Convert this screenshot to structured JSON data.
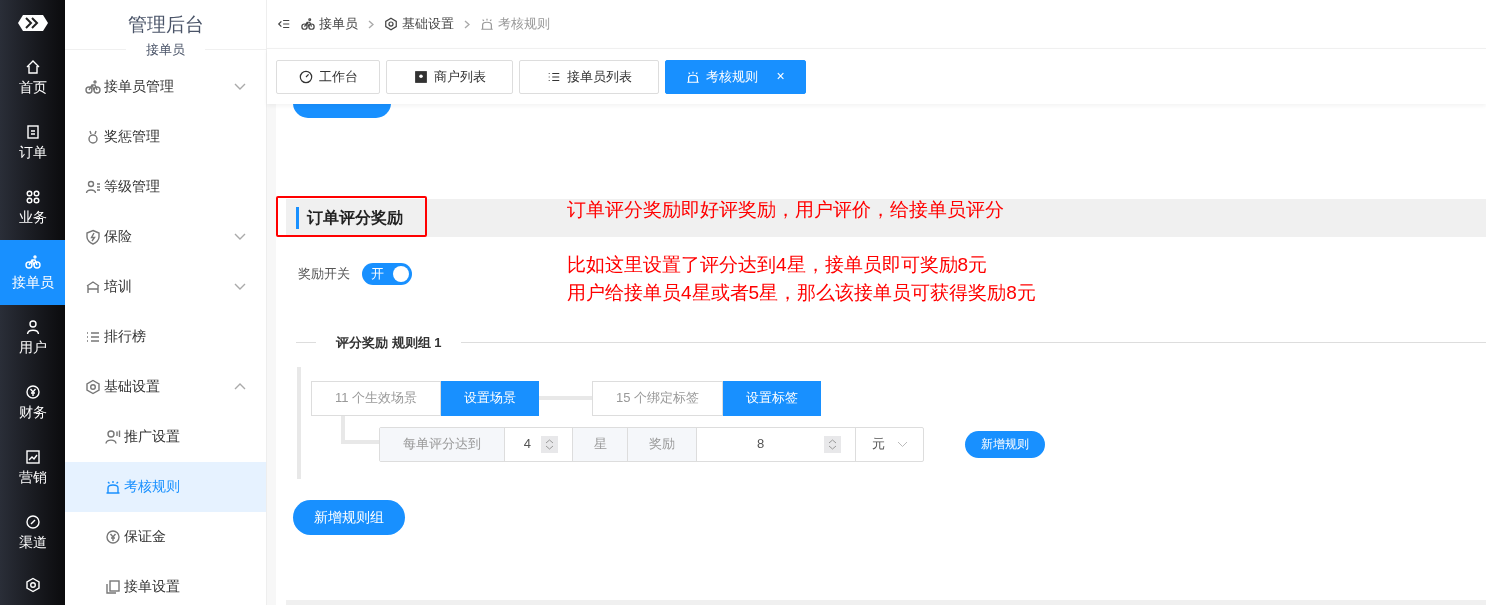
{
  "rail": {
    "items": [
      {
        "label": "首页",
        "selected": false
      },
      {
        "label": "订单",
        "selected": false
      },
      {
        "label": "业务",
        "selected": false
      },
      {
        "label": "接单员",
        "selected": true
      },
      {
        "label": "用户",
        "selected": false
      },
      {
        "label": "财务",
        "selected": false
      },
      {
        "label": "营销",
        "selected": false
      },
      {
        "label": "渠道",
        "selected": false
      }
    ]
  },
  "sidebar": {
    "title": "管理后台",
    "subtitle": "接单员",
    "items": [
      {
        "label": "接单员管理",
        "kind": "group",
        "expanded": false,
        "selected": false
      },
      {
        "label": "奖惩管理",
        "kind": "link",
        "selected": false
      },
      {
        "label": "等级管理",
        "kind": "link",
        "selected": false
      },
      {
        "label": "保险",
        "kind": "group",
        "expanded": false,
        "selected": false
      },
      {
        "label": "培训",
        "kind": "group",
        "expanded": false,
        "selected": false
      },
      {
        "label": "排行榜",
        "kind": "link",
        "selected": false
      },
      {
        "label": "基础设置",
        "kind": "group",
        "expanded": true,
        "selected": false,
        "children": [
          {
            "label": "推广设置",
            "selected": false
          },
          {
            "label": "考核规则",
            "selected": true
          },
          {
            "label": "保证金",
            "selected": false
          },
          {
            "label": "接单设置",
            "selected": false
          }
        ]
      }
    ]
  },
  "breadcrumb": [
    "接单员",
    "基础设置",
    "考核规则"
  ],
  "tabs": [
    {
      "label": "工作台",
      "selected": false
    },
    {
      "label": "商户列表",
      "selected": false
    },
    {
      "label": "接单员列表",
      "selected": false
    },
    {
      "label": "考核规则",
      "selected": true,
      "close": "×"
    }
  ],
  "section": {
    "title": "订单评分奖励",
    "switch": {
      "label": "奖励开关",
      "on": true,
      "text": "开"
    },
    "rule_group": {
      "title": "评分奖励 规则组 1",
      "scene_field": "11 个生效场景",
      "scene_button": "设置场景",
      "tag_field": "15 个绑定标签",
      "tag_button": "设置标签",
      "rule": {
        "prefix": "每单评分达到",
        "stars": "4",
        "star_unit": "星",
        "reward_label": "奖励",
        "reward": "8",
        "currency": "元"
      },
      "add_rule_button": "新增规则"
    },
    "add_group_button": "新增规则组"
  },
  "annotations": [
    "订单评分奖励即好评奖励，用户评价，给接单员评分",
    "比如这里设置了评分达到4星，接单员即可奖励8元",
    "用户给接单员4星或者5星，那么该接单员可获得奖励8元"
  ]
}
